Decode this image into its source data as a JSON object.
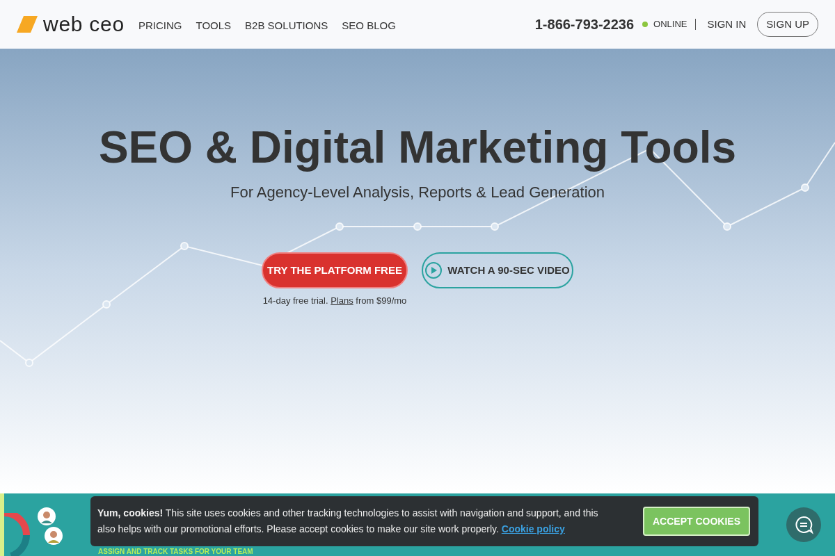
{
  "header": {
    "logo": "web ceo",
    "nav": [
      "PRICING",
      "TOOLS",
      "B2B SOLUTIONS",
      "SEO BLOG"
    ],
    "phone": "1-866-793-2236",
    "status": {
      "label": "ONLINE",
      "color": "#8cc63f"
    },
    "sign_in": "SIGN IN",
    "sign_up": "SIGN UP"
  },
  "hero": {
    "title": "SEO & Digital Marketing Tools",
    "subtitle": "For Agency-Level Analysis, Reports & Lead Generation",
    "primary_button": "TRY THE PLATFORM FREE",
    "video_button": "WATCH A 90-SEC VIDEO",
    "note_before": "14-day free trial.",
    "note_link": "Plans",
    "note_after": "from $99/mo"
  },
  "band": {
    "task_line": "ASSIGN AND TRACK TASKS FOR YOUR TEAM"
  },
  "cookie_bar": {
    "text": "**Yum, cookies!** This site uses cookies and other tracking technologies to assist with navigation and support, and this also helps with our promotional efforts. Please accept cookies to make our site work properly.",
    "link": "Cookie policy",
    "button": "ACCEPT COOKIES"
  }
}
